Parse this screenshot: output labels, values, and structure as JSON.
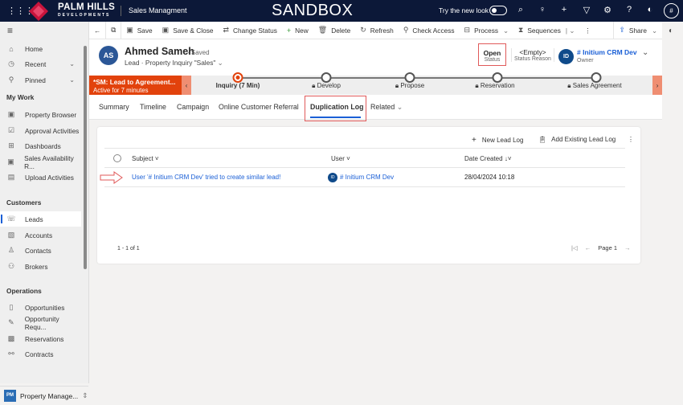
{
  "topbar": {
    "brand_line1": "PALM HILLS",
    "brand_line2": "DEVELOPMENTS",
    "app_name": "Sales Managment",
    "environment": "SANDBOX",
    "try_new_look": "Try the new look",
    "user_initial": "#"
  },
  "sidebar": {
    "items": [
      {
        "label": "Home"
      },
      {
        "label": "Recent"
      },
      {
        "label": "Pinned"
      }
    ],
    "my_work_title": "My Work",
    "my_work": [
      {
        "label": "Property Browser"
      },
      {
        "label": "Approval Activities"
      },
      {
        "label": "Dashboards"
      },
      {
        "label": "Sales Availability R..."
      },
      {
        "label": "Upload Activities"
      }
    ],
    "customers_title": "Customers",
    "customers": [
      {
        "label": "Leads"
      },
      {
        "label": "Accounts"
      },
      {
        "label": "Contacts"
      },
      {
        "label": "Brokers"
      }
    ],
    "operations_title": "Operations",
    "operations": [
      {
        "label": "Opportunities"
      },
      {
        "label": "Opportunity Requ..."
      },
      {
        "label": "Reservations"
      },
      {
        "label": "Contracts"
      }
    ],
    "area_badge": "PM",
    "area_label": "Property Manage..."
  },
  "commands": {
    "save": "Save",
    "save_close": "Save & Close",
    "change_status": "Change Status",
    "new": "New",
    "delete": "Delete",
    "refresh": "Refresh",
    "check_access": "Check Access",
    "process": "Process",
    "sequences": "Sequences",
    "share": "Share"
  },
  "record": {
    "initials": "AS",
    "name": "Ahmed Sameh",
    "saved": "- Saved",
    "entity": "Lead",
    "form": "Property Inquiry \"Sales\"",
    "status_value": "Open",
    "status_label": "Status",
    "reason_value": "<Empty>",
    "reason_label": "Status Reason",
    "owner_initials": "ID",
    "owner_name": "# Initium CRM Dev",
    "owner_label": "Owner"
  },
  "bpf": {
    "title": "*SM: Lead to Agreement...",
    "active_for": "Active for 7 minutes",
    "stages": [
      {
        "label": "Inquiry  (7 Min)"
      },
      {
        "label": "Develop"
      },
      {
        "label": "Propose"
      },
      {
        "label": "Reservation"
      },
      {
        "label": "Sales Agreement"
      }
    ]
  },
  "tabs": [
    {
      "label": "Summary"
    },
    {
      "label": "Timeline"
    },
    {
      "label": "Campaign"
    },
    {
      "label": "Online Customer Referral"
    },
    {
      "label": "Duplication Log"
    },
    {
      "label": "Related"
    }
  ],
  "grid": {
    "new_label": "New Lead Log",
    "add_existing_label": "Add Existing Lead Log",
    "columns": {
      "subject": "Subject",
      "user": "User",
      "date": "Date Created"
    },
    "rows": [
      {
        "subject": "User '# Initium CRM Dev' tried to create similar lead!",
        "user_initials": "ID",
        "user": "# Initium CRM Dev",
        "date": "28/04/2024 10:18"
      }
    ],
    "count": "1 - 1 of 1",
    "page": "Page 1"
  }
}
